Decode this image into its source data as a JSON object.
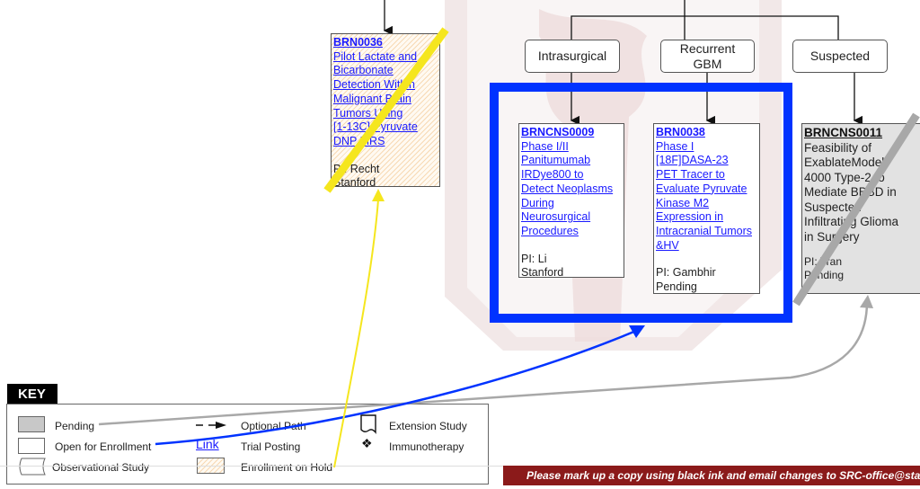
{
  "diagram": {
    "categories": [
      {
        "id": "intrasurgical",
        "label": "Intrasurgical"
      },
      {
        "id": "recurrent-gbm",
        "label": "Recurrent GBM",
        "line1": "Recurrent",
        "line2": "GBM"
      },
      {
        "id": "suspected",
        "label": "Suspected"
      }
    ],
    "trials": [
      {
        "id": "BRN0036",
        "lines": [
          "Pilot Lactate and",
          "Bicarbonate",
          "Detection Within",
          "Malignant Brain",
          "Tumors Using",
          "[1-13C] Pyruvate",
          "DNP MRS"
        ],
        "pi": "PI: Recht",
        "site": "Stanford",
        "status": "Enrollment on Hold",
        "crossed_out": true,
        "cross_color": "#f5e61e"
      },
      {
        "id": "BRNCNS0009",
        "lines": [
          "Phase I/II",
          "Panitumumab",
          "IRDye800 to",
          "Detect Neoplasms",
          "During",
          "Neurosurgical",
          "Procedures"
        ],
        "pi": "PI: Li",
        "site": "Stanford",
        "status": "Open for Enrollment"
      },
      {
        "id": "BRN0038",
        "lines": [
          "Phase I",
          "[18F]DASA-23",
          "PET Tracer to",
          "Evaluate Pyruvate",
          "Kinase M2",
          "Expression in",
          "Intracranial Tumors",
          "&HV"
        ],
        "pi": "PI: Gambhir",
        "site": "Pending",
        "status": "Open for Enrollment"
      },
      {
        "id": "BRNCNS0011",
        "lines": [
          "Feasibility of",
          "ExablateModel",
          "4000 Type-2 to",
          "Mediate BBBD in",
          "Suspected",
          "Infiltrating Glioma",
          "in Surgery"
        ],
        "pi": "PI: Tran",
        "site": "Pending",
        "status": "Pending",
        "crossed_out": true,
        "cross_color": "#a8a8a8"
      }
    ],
    "annotations": {
      "highlight_color": "#0033ff",
      "hold_arrow_color": "#f5e61e",
      "pending_arrow_color": "#a8a8a8"
    }
  },
  "key": {
    "title": "KEY",
    "items": [
      {
        "symbol": "gray-box",
        "label": "Pending"
      },
      {
        "symbol": "white-box",
        "label": "Open for Enrollment"
      },
      {
        "symbol": "observational-shape",
        "label": "Observational Study"
      },
      {
        "symbol": "dashed-arrow",
        "label": "Optional Path"
      },
      {
        "symbol": "link-text",
        "symbol_text": "Link",
        "label": "Trial Posting"
      },
      {
        "symbol": "hatched-box",
        "label": "Enrollment on Hold"
      },
      {
        "symbol": "extension-shape",
        "label": "Extension Study"
      },
      {
        "symbol": "diamond-cluster",
        "symbol_text": "❖",
        "label": "Immunotherapy"
      }
    ]
  },
  "footer": {
    "text": "Please mark up a copy using black ink and email changes to SRC-office@stanford.edu",
    "color": "#8b1a1a"
  }
}
